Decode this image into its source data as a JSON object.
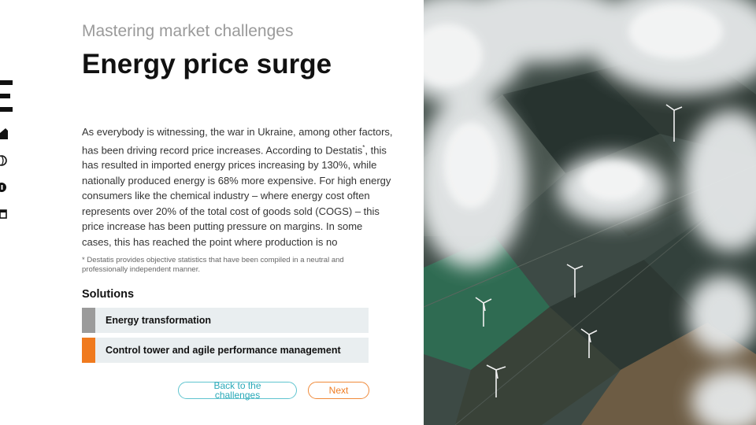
{
  "rail": {
    "icons": [
      "menu-icon",
      "home-icon",
      "globe-icon",
      "info-icon",
      "calendar-icon"
    ]
  },
  "header": {
    "kicker": "Mastering market challenges",
    "title": "Energy price surge"
  },
  "body": {
    "paragraph_part1": "As everybody is witnessing, the war in Ukraine, among other factors, has been driving record price increases. According to Destatis",
    "paragraph_sup": "*",
    "paragraph_part2": ", this has resulted in imported energy prices increasing by 130%, while nationally produced energy is 68% more expensive. For high energy consumers like the chemical industry – where energy cost often represents over 20% of the total cost of goods sold (COGS) – this price increase has been putting pressure on margins. In some cases, this has reached the point where production is no",
    "footnote": "* Destatis provides objective statistics that have been compiled in a neutral and professionally independent manner."
  },
  "solutions": {
    "heading": "Solutions",
    "items": [
      {
        "label": "Energy transformation",
        "color": "#9b9b9b"
      },
      {
        "label": "Control tower and agile performance management",
        "color": "#f07a1e"
      }
    ]
  },
  "buttons": {
    "back_label": "Back to the challenges",
    "next_label": "Next",
    "back_color": "#2aa9b8",
    "next_color": "#ef7d23"
  },
  "photo": {
    "description_icon": "aerial-wind-farm-clouds-image"
  }
}
